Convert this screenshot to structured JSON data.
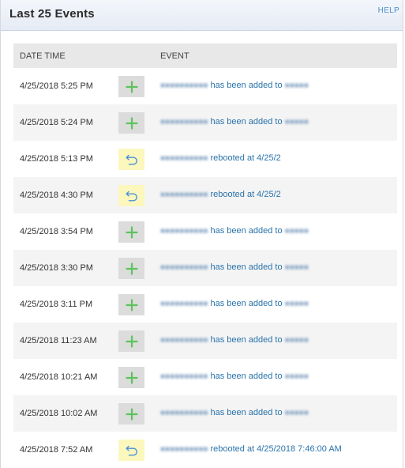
{
  "panel": {
    "title": "Last 25 Events",
    "help": "HELP"
  },
  "table": {
    "headers": {
      "date_time": "DATE TIME",
      "event": "EVENT"
    },
    "rows": [
      {
        "date": "4/25/2018 5:25 PM",
        "icon": "plus-icon",
        "type": "added",
        "subject": "",
        "text": "has been added to",
        "target": ""
      },
      {
        "date": "4/25/2018 5:24 PM",
        "icon": "plus-icon",
        "type": "added",
        "subject": "",
        "text": "has been added to",
        "target": ""
      },
      {
        "date": "4/25/2018 5:13 PM",
        "icon": "reboot-icon",
        "type": "reboot",
        "subject": "",
        "text": "rebooted at 4/25/2",
        "target": ""
      },
      {
        "date": "4/25/2018 4:30 PM",
        "icon": "reboot-icon",
        "type": "reboot",
        "subject": "",
        "text": "rebooted at 4/25/2",
        "target": ""
      },
      {
        "date": "4/25/2018 3:54 PM",
        "icon": "plus-icon",
        "type": "added",
        "subject": "",
        "text": "has been added to",
        "target": ""
      },
      {
        "date": "4/25/2018 3:30 PM",
        "icon": "plus-icon",
        "type": "added",
        "subject": "",
        "text": "has been added to",
        "target": ""
      },
      {
        "date": "4/25/2018 3:11 PM",
        "icon": "plus-icon",
        "type": "added",
        "subject": "",
        "text": "has been added to",
        "target": ""
      },
      {
        "date": "4/25/2018 11:23 AM",
        "icon": "plus-icon",
        "type": "added",
        "subject": "",
        "text": "has been added to",
        "target": ""
      },
      {
        "date": "4/25/2018 10:21 AM",
        "icon": "plus-icon",
        "type": "added",
        "subject": "",
        "text": "has been added to",
        "target": ""
      },
      {
        "date": "4/25/2018 10:02 AM",
        "icon": "plus-icon",
        "type": "added",
        "subject": "",
        "text": "has been added to",
        "target": ""
      },
      {
        "date": "4/25/2018 7:52 AM",
        "icon": "reboot-icon",
        "type": "reboot",
        "subject": "",
        "text": "rebooted at 4/25/2018 7:46:00 AM",
        "target": ""
      }
    ]
  },
  "colors": {
    "plus": "#5cc35c",
    "reboot": "#4a90d9",
    "link": "#2a73aa"
  }
}
